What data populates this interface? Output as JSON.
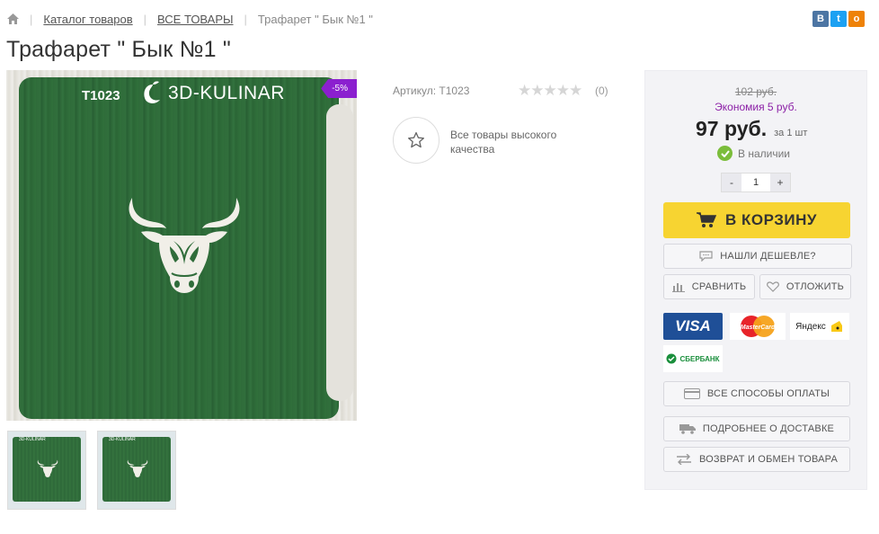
{
  "breadcrumb": {
    "items": [
      "Каталог товаров",
      "ВСЕ ТОВАРЫ"
    ],
    "current": "Трафарет \" Бык №1 \""
  },
  "social": {
    "vk": "В",
    "twitter": "t",
    "ok": "о"
  },
  "product": {
    "title": "Трафарет \" Бык №1 \"",
    "image": {
      "code": "T1023",
      "brand": "3D-KULINAR",
      "discount": "-5%"
    },
    "article_label": "Артикул: T1023",
    "rating_stars": 0,
    "reviews_count": "(0)",
    "quality_text": "Все товары высокого качества"
  },
  "buy": {
    "old_price": "102 руб.",
    "savings": "Экономия 5 руб.",
    "price": "97 руб.",
    "unit": "за 1 шт",
    "stock": "В наличии",
    "quantity": "1",
    "qty_minus": "-",
    "qty_plus": "+",
    "cart_label": "В КОРЗИНУ",
    "cheaper_label": "НАШЛИ ДЕШЕВЛЕ?",
    "compare_label": "СРАВНИТЬ",
    "defer_label": "ОТЛОЖИТЬ",
    "payment_logos": [
      "VISA",
      "MasterCard",
      "Яндекс",
      "СБЕРБАНК"
    ],
    "pay_methods_label": "ВСЕ СПОСОБЫ ОПЛАТЫ",
    "delivery_label": "ПОДРОБНЕЕ О ДОСТАВКЕ",
    "return_label": "ВОЗВРАТ И ОБМЕН ТОВАРА"
  },
  "colors": {
    "accent_purple": "#8b1fcf",
    "cart_yellow": "#f7d431",
    "stencil_green": "#2f6c3a",
    "stock_green": "#7bbd3b"
  }
}
